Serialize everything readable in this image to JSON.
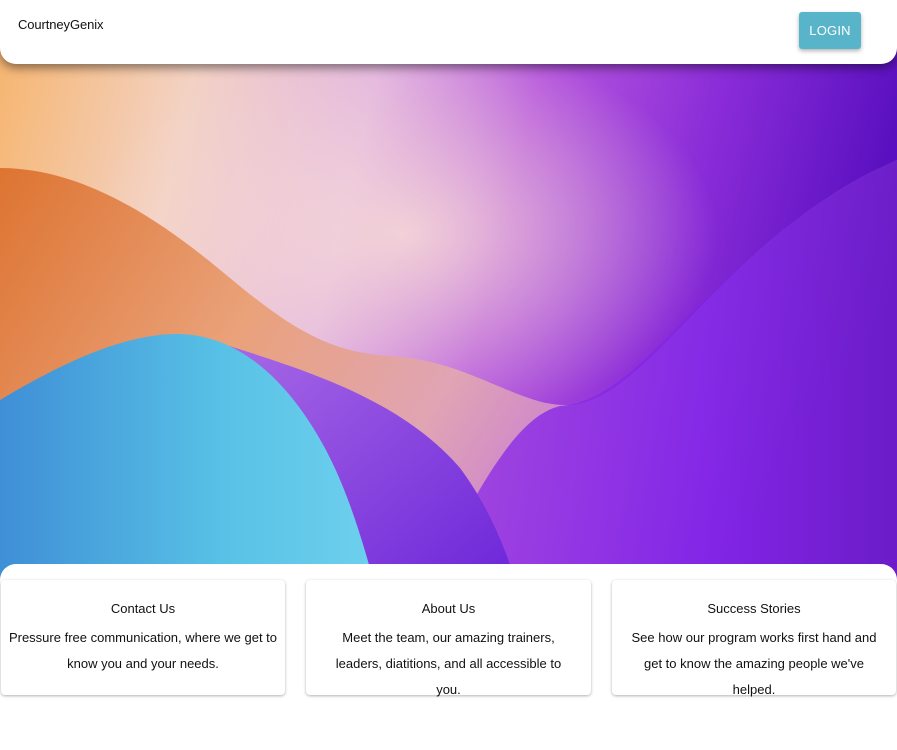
{
  "header": {
    "brand": "CourtneyGenix",
    "login_label": "LOGIN"
  },
  "colors": {
    "accent": "#58b4c9",
    "orange": "#e07a2c",
    "purple": "#7a1fe0",
    "blue": "#4fb8e6"
  },
  "cards": [
    {
      "title": "Contact Us",
      "text": "Pressure free communication, where we get to know you and your needs."
    },
    {
      "title": "About Us",
      "text": "Meet the team, our amazing trainers, leaders, diatitions, and all accessible to you."
    },
    {
      "title": "Success Stories",
      "text": "See how our program works first hand and get to know the amazing people we've helped."
    }
  ]
}
